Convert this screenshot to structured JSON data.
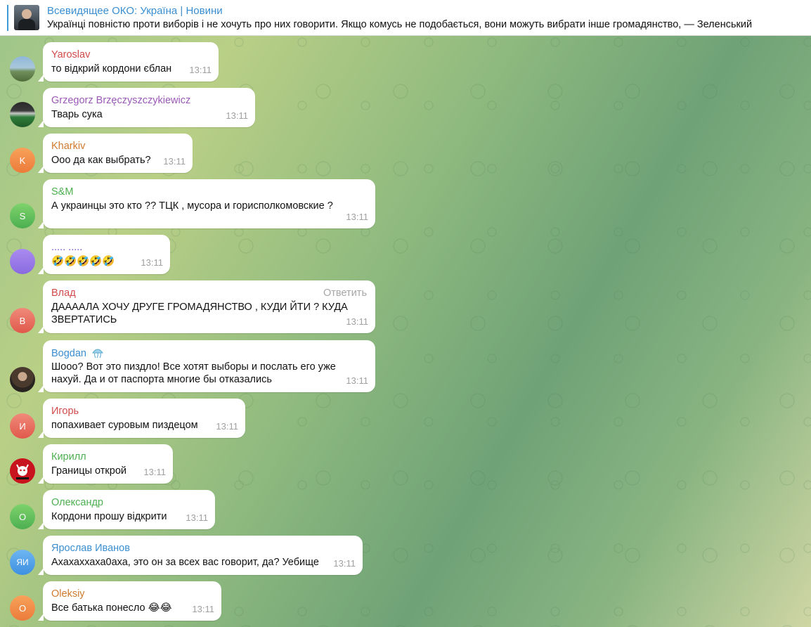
{
  "pinned": {
    "title": "Всевидящее ОКО: Україна | Новини",
    "text": "Українці повністю проти виборів і не хочуть про них говорити. Якщо комусь не подобається, вони можуть вибрати інше громадянство, — Зеленський"
  },
  "colors": {
    "pinned_accent": "#3f9bd8",
    "bubble_bg": "#ffffff",
    "time_text": "#a0a0a0"
  },
  "messages": [
    {
      "name": "Yaroslav",
      "text": "то відкрий кордони єблан",
      "time": "13:11",
      "avatar": "photo-landscape",
      "name_color": "#d14b4b"
    },
    {
      "name": "Grzegorz Brzęczyszczykiewicz",
      "text": "Тварь сука",
      "time": "13:11",
      "avatar": "photo-stadium",
      "name_color": "#9b59b6"
    },
    {
      "name": "Kharkiv",
      "text": "Ооо да как выбрать?",
      "time": "13:11",
      "avatar_initials": "K",
      "name_color": "#cf7a2e"
    },
    {
      "name": "S&M",
      "text": "А украинцы это кто ?? ТЦК , мусора и горисполкомовские ?",
      "time": "13:11",
      "avatar_initials": "S",
      "name_color": "#4caf50"
    },
    {
      "name": "..... .....",
      "text": "🤣🤣🤣🤣🤣",
      "time": "13:11",
      "avatar": "purple-blank",
      "name_color": "#7b4fc5"
    },
    {
      "name": "Влад",
      "text_line1": "ДААААЛА ХОЧУ ДРУГЕ ГРОМАДЯНСТВО , КУДИ ЙТИ ? КУДА",
      "text_line2": "ЗВЕРТАТИСЬ",
      "time": "13:11",
      "avatar_initials": "В",
      "name_color": "#d14b4b",
      "reply_label": "Ответить"
    },
    {
      "name": "Bogdan",
      "name_icon": "jellyfish-icon",
      "text_line1": "Шооо? Вот это пиздло! Все хотят выборы и послать его уже",
      "text_line2": "нахуй. Да и от паспорта многие бы отказались",
      "time": "13:11",
      "avatar": "photo-person",
      "name_color": "#3a8ed0"
    },
    {
      "name": "Игорь",
      "text": "попахивает суровым пиздецом",
      "time": "13:11",
      "avatar_initials": "И",
      "name_color": "#d14b4b"
    },
    {
      "name": "Кирилл",
      "text": "Границы открой",
      "time": "13:11",
      "avatar": "red-logo",
      "name_color": "#4caf50"
    },
    {
      "name": "Олександр",
      "text": "Кордони прошу відкрити",
      "time": "13:11",
      "avatar_initials": "О",
      "name_color": "#4caf50"
    },
    {
      "name": "Ярослав Иванов",
      "text": "Ахахаххаха0аха, это он за всех вас говорит, да? Уебище",
      "time": "13:11",
      "avatar_initials": "ЯИ",
      "name_color": "#3a8ed0"
    },
    {
      "name": "Oleksiy",
      "text": "Все батька понесло 😂😂",
      "time": "13:11",
      "avatar_initials": "O",
      "name_color": "#cf7a2e"
    }
  ]
}
